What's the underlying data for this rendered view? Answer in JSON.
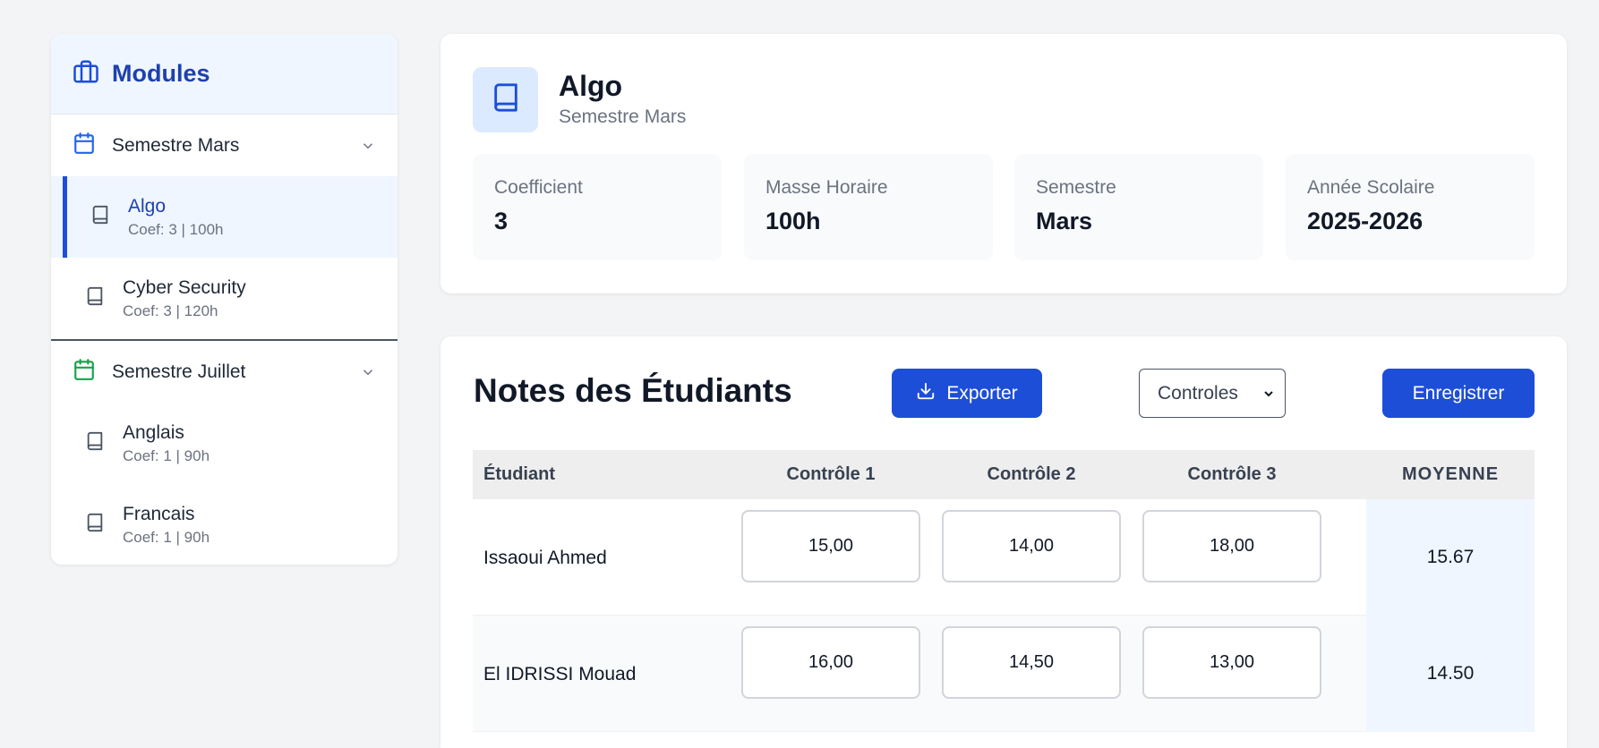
{
  "sidebar": {
    "title": "Modules",
    "semesters": [
      {
        "label": "Semestre Mars",
        "color": "#2563eb",
        "modules": [
          {
            "name": "Algo",
            "meta": "Coef: 3 | 100h",
            "active": true
          },
          {
            "name": "Cyber Security",
            "meta": "Coef: 3 | 120h",
            "active": false
          }
        ]
      },
      {
        "label": "Semestre Juillet",
        "color": "#16a34a",
        "modules": [
          {
            "name": "Anglais",
            "meta": "Coef: 1 | 90h",
            "active": false
          },
          {
            "name": "Francais",
            "meta": "Coef: 1 | 90h",
            "active": false
          }
        ]
      }
    ]
  },
  "module": {
    "title": "Algo",
    "subtitle": "Semestre Mars",
    "stats": [
      {
        "label": "Coefficient",
        "value": "3"
      },
      {
        "label": "Masse Horaire",
        "value": "100h"
      },
      {
        "label": "Semestre",
        "value": "Mars"
      },
      {
        "label": "Année Scolaire",
        "value": "2025-2026"
      }
    ]
  },
  "grades": {
    "title": "Notes des Étudiants",
    "export_label": "Exporter",
    "select_value": "Controles",
    "save_label": "Enregistrer",
    "columns": [
      "Étudiant",
      "Contrôle 1",
      "Contrôle 2",
      "Contrôle 3",
      "MOYENNE"
    ],
    "rows": [
      {
        "student": "Issaoui Ahmed",
        "c1": "15,00",
        "c2": "14,00",
        "c3": "18,00",
        "avg": "15.67"
      },
      {
        "student": "El IDRISSI Mouad",
        "c1": "16,00",
        "c2": "14,50",
        "c3": "13,00",
        "avg": "14.50"
      }
    ]
  },
  "colors": {
    "accent": "#1d4ed8",
    "accent_light": "#eff6ff",
    "green": "#16a34a"
  }
}
